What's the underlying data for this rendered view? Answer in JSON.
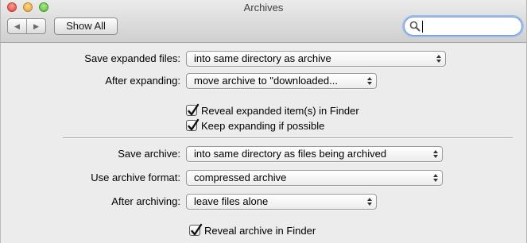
{
  "window": {
    "title": "Archives"
  },
  "toolbar": {
    "show_all_label": "Show All",
    "search_placeholder": ""
  },
  "expand": {
    "save_label": "Save expanded files:",
    "save_value": "into same directory as archive",
    "after_label": "After expanding:",
    "after_value": "move archive to \"downloaded...",
    "reveal_label": "Reveal expanded item(s) in Finder",
    "reveal_checked": true,
    "keep_label": "Keep expanding if possible",
    "keep_checked": true
  },
  "archive": {
    "save_label": "Save archive:",
    "save_value": "into same directory as files being archived",
    "format_label": "Use archive format:",
    "format_value": "compressed archive",
    "after_label": "After archiving:",
    "after_value": "leave files alone",
    "reveal_label": "Reveal archive in Finder",
    "reveal_checked": true
  }
}
